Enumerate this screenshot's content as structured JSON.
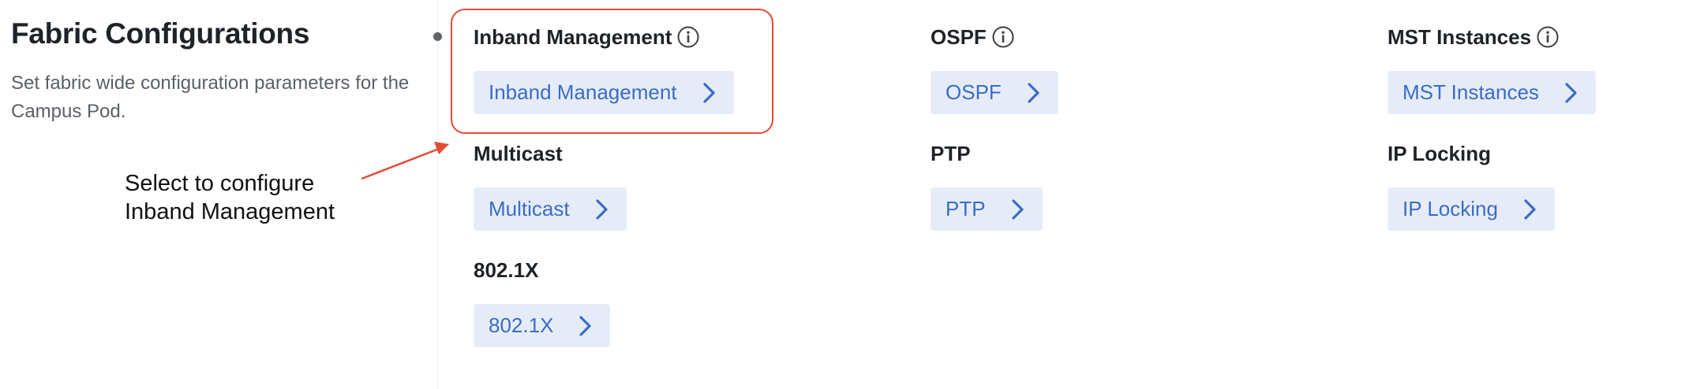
{
  "intro": {
    "title": "Fabric Configurations",
    "description": "Set fabric wide configuration parameters for the Campus Pod."
  },
  "annotation": {
    "line1": "Select to configure",
    "line2": "Inband Management",
    "color": "#e44b34"
  },
  "items": [
    {
      "title": "Inband Management",
      "button": "Inband Management",
      "has_info": true
    },
    {
      "title": "OSPF",
      "button": "OSPF",
      "has_info": true
    },
    {
      "title": "MST Instances",
      "button": "MST Instances",
      "has_info": true
    },
    {
      "title": "Multicast",
      "button": "Multicast",
      "has_info": false
    },
    {
      "title": "PTP",
      "button": "PTP",
      "has_info": false
    },
    {
      "title": "IP Locking",
      "button": "IP Locking",
      "has_info": false
    },
    {
      "title": "802.1X",
      "button": "802.1X",
      "has_info": false
    }
  ],
  "colors": {
    "button_bg": "#e6ecf7",
    "button_text": "#3a6cc6",
    "heading": "#1f2328",
    "muted_text": "#5b5f66"
  },
  "icons": {
    "info": "info-circle-icon",
    "chevron": "chevron-right-icon"
  }
}
